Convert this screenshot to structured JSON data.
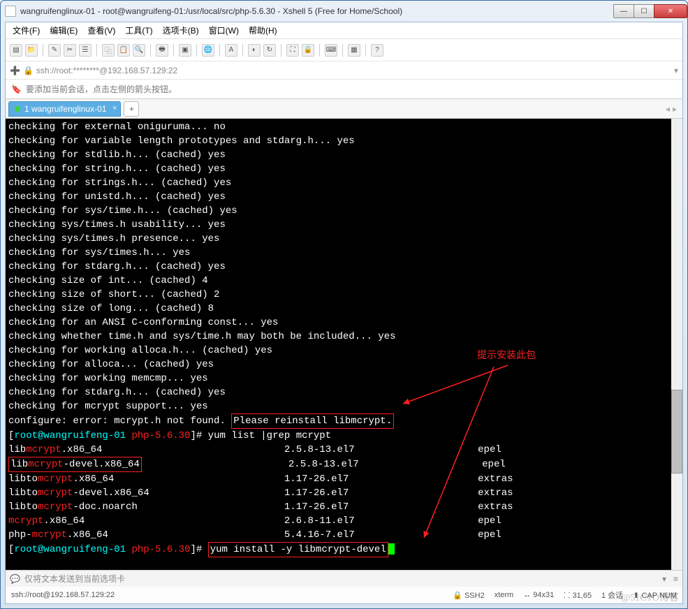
{
  "titlebar": {
    "text": "wangruifenglinux-01 - root@wangruifeng-01:/usr/local/src/php-5.6.30 - Xshell 5 (Free for Home/School)"
  },
  "menus": {
    "file": "文件(F)",
    "edit": "编辑(E)",
    "view": "查看(V)",
    "tool": "工具(T)",
    "tab": "选项卡(B)",
    "window": "窗口(W)",
    "help": "帮助(H)"
  },
  "address": {
    "text": "ssh://root:********@192.168.57.129:22"
  },
  "hint": {
    "text": "要添加当前会话，点击左侧的箭头按钮。"
  },
  "tab": {
    "label": "1 wangruifenglinux-01"
  },
  "annotation": {
    "text": "提示安装此包"
  },
  "terminal_lines": [
    {
      "t": "checking for external oniguruma... no"
    },
    {
      "t": "checking for variable length prototypes and stdarg.h... yes"
    },
    {
      "t": "checking for stdlib.h... (cached) yes"
    },
    {
      "t": "checking for string.h... (cached) yes"
    },
    {
      "t": "checking for strings.h... (cached) yes"
    },
    {
      "t": "checking for unistd.h... (cached) yes"
    },
    {
      "t": "checking for sys/time.h... (cached) yes"
    },
    {
      "t": "checking sys/times.h usability... yes"
    },
    {
      "t": "checking sys/times.h presence... yes"
    },
    {
      "t": "checking for sys/times.h... yes"
    },
    {
      "t": "checking for stdarg.h... (cached) yes"
    },
    {
      "t": "checking size of int... (cached) 4"
    },
    {
      "t": "checking size of short... (cached) 2"
    },
    {
      "t": "checking size of long... (cached) 8"
    },
    {
      "t": "checking for an ANSI C-conforming const... yes"
    },
    {
      "t": "checking whether time.h and sys/time.h may both be included... yes"
    },
    {
      "t": "checking for working alloca.h... (cached) yes"
    },
    {
      "t": "checking for alloca... (cached) yes"
    },
    {
      "t": "checking for working memcmp... yes"
    },
    {
      "t": "checking for stdarg.h... (cached) yes"
    },
    {
      "t": "checking for mcrypt support... yes"
    }
  ],
  "err_prefix": "configure: error: mcrypt.h not found. ",
  "err_box": "Please reinstall libmcrypt.",
  "prompt": {
    "user": "root@wangruifeng-01",
    "dir": " php-5.6.30",
    "cmd1": "yum list |grep mcrypt",
    "cmd2": "yum install -y libmcrypt-devel"
  },
  "pkgs": [
    {
      "n1": "lib",
      "h": "mcrypt",
      "n2": ".x86_64",
      "v": "2.5.8-13.el7",
      "r": "epel"
    },
    {
      "n1": "lib",
      "h": "mcrypt",
      "n2": "-devel.x86_64",
      "v": "2.5.8-13.el7",
      "r": "epel",
      "box": true
    },
    {
      "n1": "libto",
      "h": "mcrypt",
      "n2": ".x86_64",
      "v": "1.17-26.el7",
      "r": "extras"
    },
    {
      "n1": "libto",
      "h": "mcrypt",
      "n2": "-devel.x86_64",
      "v": "1.17-26.el7",
      "r": "extras"
    },
    {
      "n1": "libto",
      "h": "mcrypt",
      "n2": "-doc.noarch",
      "v": "1.17-26.el7",
      "r": "extras"
    },
    {
      "n1": "",
      "h": "mcrypt",
      "n2": ".x86_64",
      "v": "2.6.8-11.el7",
      "r": "epel"
    },
    {
      "n1": "php-",
      "h": "mcrypt",
      "n2": ".x86_64",
      "v": "5.4.16-7.el7",
      "r": "epel"
    }
  ],
  "status1": {
    "text": "仅将文本发送到当前选项卡"
  },
  "status2": {
    "conn": "ssh://root@192.168.57.129:22",
    "ssh": "SSH2",
    "term": "xterm",
    "size": "94x31",
    "pos": "31,65",
    "sess": "1 会话",
    "cap": "CAP",
    "num": "NUM"
  },
  "watermark": "@51CTO博客"
}
